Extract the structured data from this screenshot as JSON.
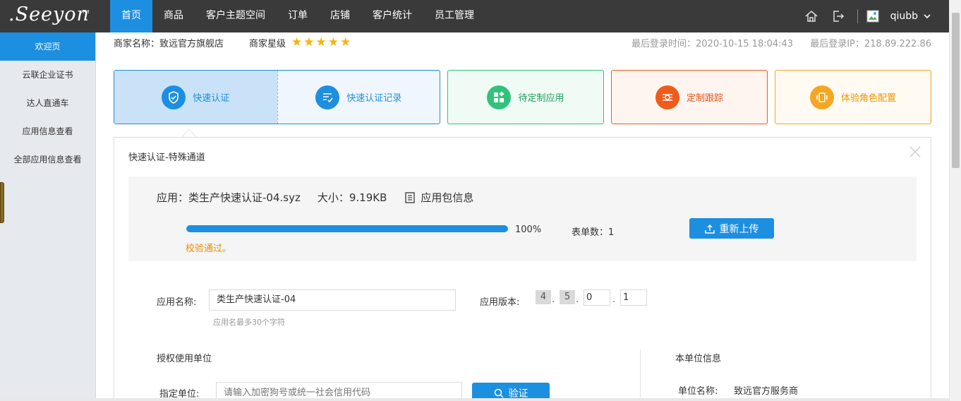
{
  "brand": {
    "logo_text": ".Seeyon",
    "tm": "TM"
  },
  "nav": {
    "items": [
      {
        "label": "首页",
        "active": true
      },
      {
        "label": "商品"
      },
      {
        "label": "客户主题空间"
      },
      {
        "label": "订单"
      },
      {
        "label": "店铺"
      },
      {
        "label": "客户统计"
      },
      {
        "label": "员工管理"
      }
    ],
    "username": "qiubb"
  },
  "sidebar": {
    "items": [
      {
        "label": "欢迎页",
        "active": true
      },
      {
        "label": "云联企业证书"
      },
      {
        "label": "达人直通车"
      },
      {
        "label": "应用信息查看"
      },
      {
        "label": "全部应用信息查看"
      }
    ]
  },
  "merchant": {
    "name_label": "商家名称：致远官方旗舰店",
    "rating_label": "商家星级",
    "stars": 5,
    "last_login_time": "最后登录时间：2020-10-15 18:04:43",
    "last_login_ip": "最后登录IP：218.89.222.86"
  },
  "tabs": {
    "quick_cert": "快速认证",
    "quick_cert_record": "快速认证记录",
    "pending_custom": "待定制应用",
    "custom_tracking": "定制跟踪",
    "role_config": "体验角色配置"
  },
  "panel": {
    "title": "快速认证-特殊通道",
    "upload": {
      "app_text": "应用：类生产快速认证-04.syz",
      "size_text": "大小：9.19KB",
      "pkg_info": "应用包信息",
      "progress": 100,
      "progress_text": "100%",
      "form_count": "表单数：1",
      "status": "校验通过。",
      "reupload_label": "重新上传"
    },
    "form": {
      "app_name_label": "应用名称:",
      "app_name_value": "类生产快速认证-04",
      "app_name_hint": "应用名最多30个字符",
      "app_version_label": "应用版本:",
      "version": [
        "4",
        "5",
        "0",
        "1"
      ],
      "auth_unit_title": "授权使用单位",
      "assign_unit_label": "指定单位:",
      "assign_unit_placeholder": "请输入加密狗号或统一社会信用代码",
      "verify_label": "验证",
      "own_unit_title": "本单位信息",
      "unit_name_label": "单位名称:",
      "unit_name_value": "致远官方服务商"
    }
  },
  "colors": {
    "primary": "#1d8fe0",
    "green": "#31c27c",
    "red": "#f05a1a",
    "orange": "#f5a623",
    "star": "#f7b500"
  }
}
